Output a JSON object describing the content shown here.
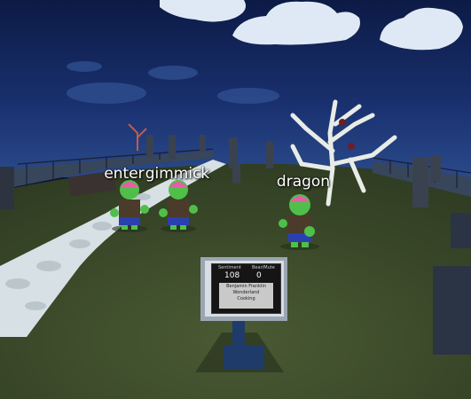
{
  "players": [
    {
      "name": "enter"
    },
    {
      "name": "gimmick"
    },
    {
      "name": "dragon"
    }
  ],
  "sign": {
    "label_a": "Sentiment",
    "label_b": "Bear/Mute",
    "value_a": "108",
    "value_b": "0",
    "lines": [
      "Benjamin Franklin",
      "Wonderland",
      "Cooking"
    ]
  },
  "colors": {
    "sky": "#14285a",
    "ground": "#3c4a2a",
    "path": "#c9d3d8",
    "zombie_skin": "#4fbf4a",
    "zombie_brain": "#e35fa5",
    "zombie_pants": "#2a3fb0"
  }
}
